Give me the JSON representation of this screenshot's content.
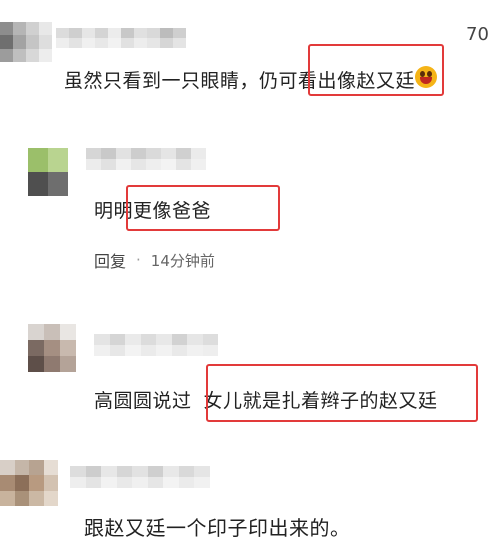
{
  "comments": [
    {
      "likes": "70",
      "text_before": "虽然只看到一只眼睛，仍可看",
      "text_highlight": "出像赵又廷",
      "emoji": "grinning-face-emoji"
    },
    {
      "text_highlight": "明明更像爸爸",
      "reply_label": "回复",
      "dot": "·",
      "time": "14分钟前"
    },
    {
      "text_before": "高圆圆说过",
      "text_highlight": "女儿就是扎着辫子的赵又廷"
    },
    {
      "text": "跟赵又廷一个印子印出来的。"
    }
  ],
  "colors": {
    "highlight_border": "#e23a3a",
    "text": "#222222",
    "meta": "#666666"
  }
}
